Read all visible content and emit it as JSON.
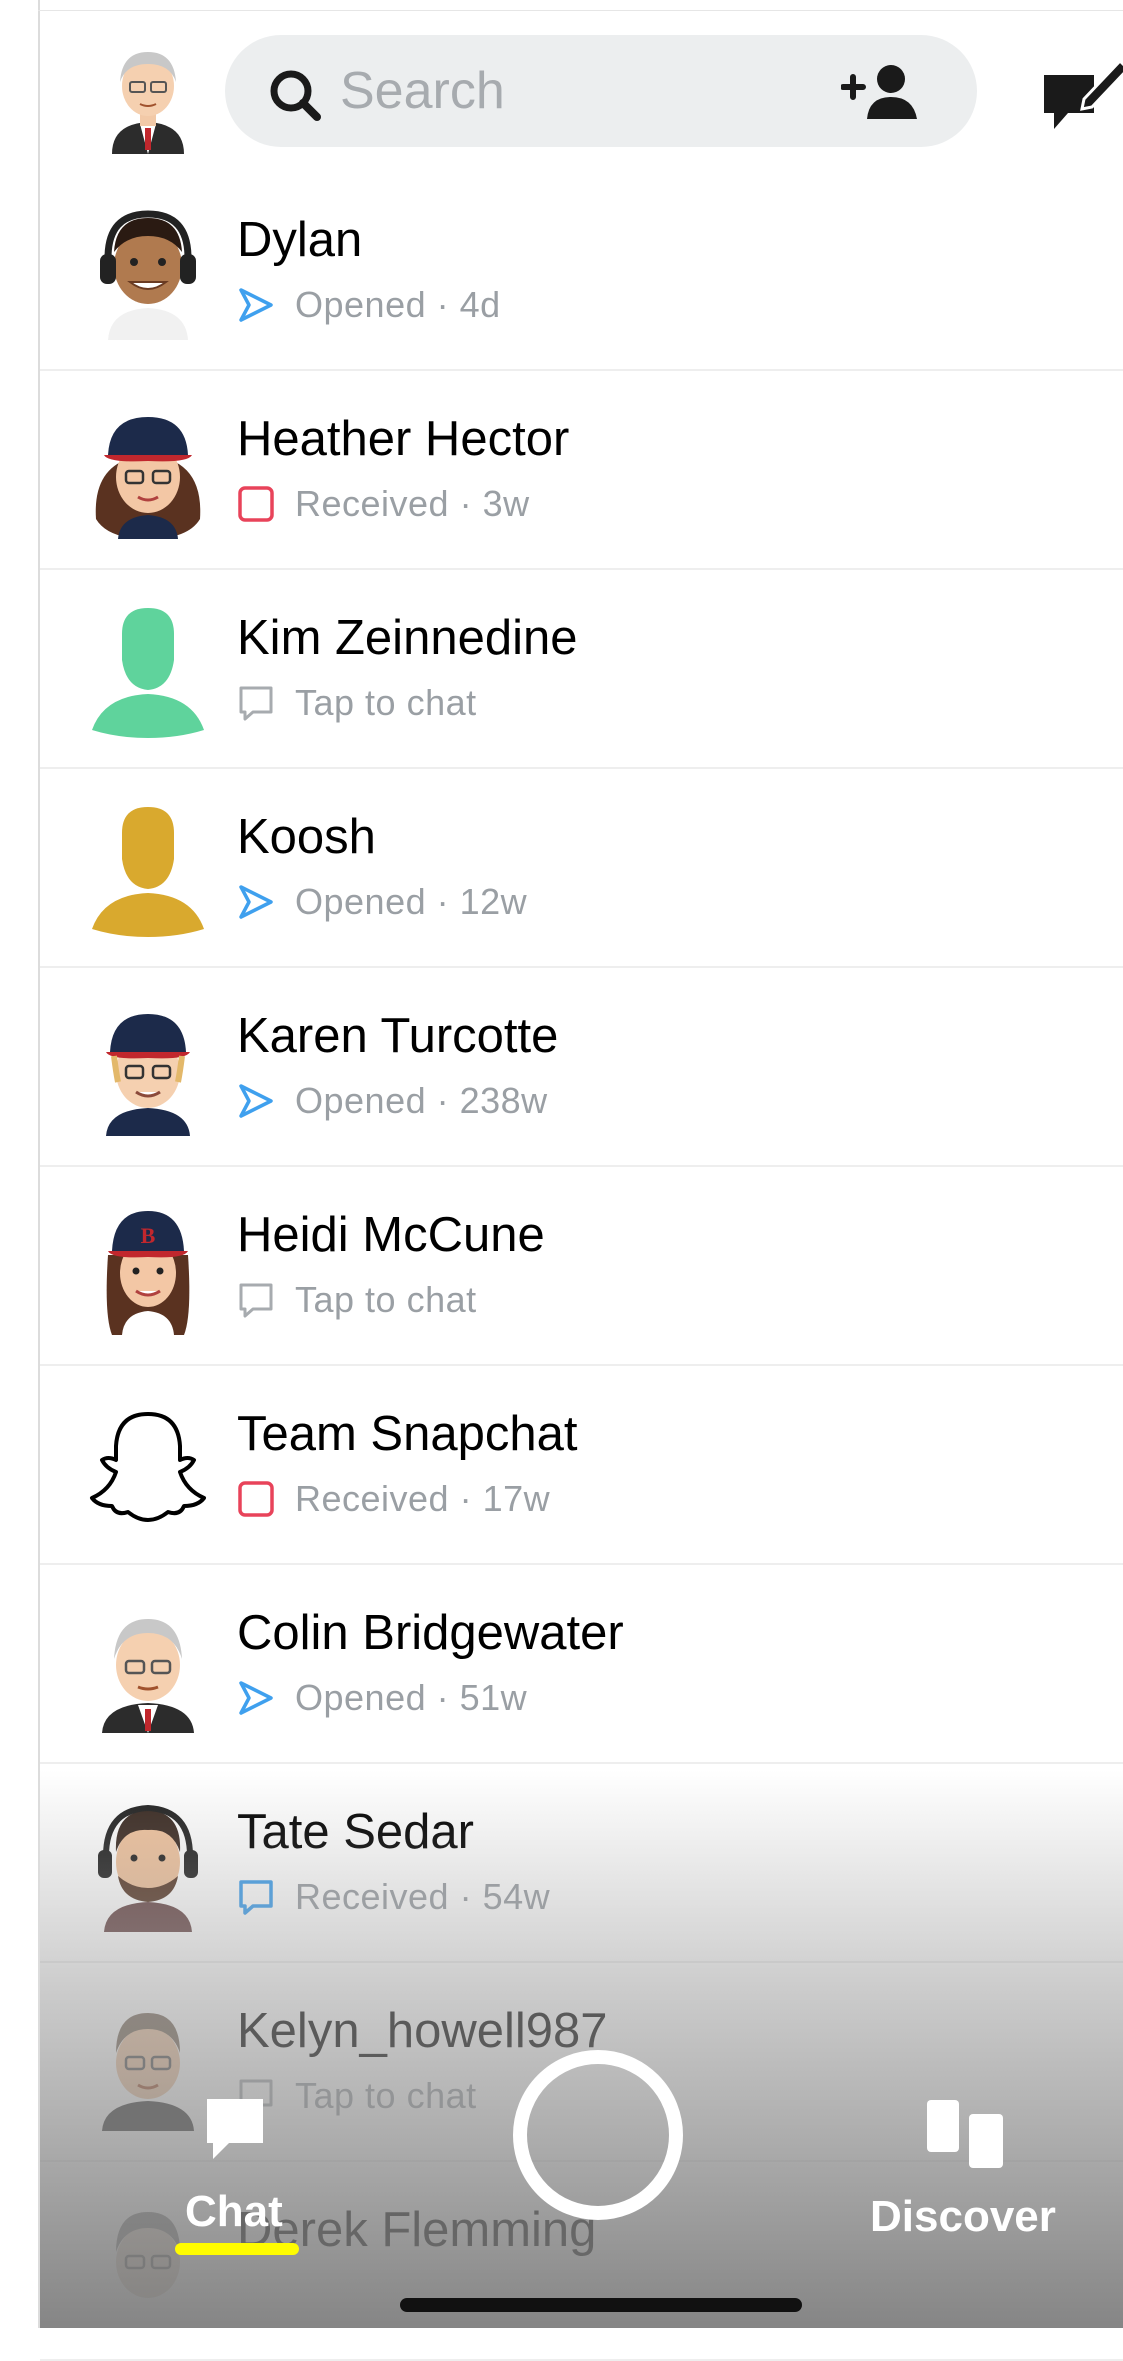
{
  "header": {
    "search_placeholder": "Search"
  },
  "chats": [
    {
      "name": "Dylan",
      "status": "Opened · 4d",
      "status_type": "opened",
      "avatar": "bitmoji-headphones"
    },
    {
      "name": "Heather Hector",
      "status": "Received · 3w",
      "status_type": "received-snap",
      "avatar": "bitmoji-cap-glasses"
    },
    {
      "name": "Kim Zeinnedine",
      "status": "Tap to chat",
      "status_type": "tap",
      "avatar": "silhouette",
      "avatar_color": "#5fd39c"
    },
    {
      "name": "Koosh",
      "status": "Opened · 12w",
      "status_type": "opened",
      "avatar": "silhouette",
      "avatar_color": "#d9a92e"
    },
    {
      "name": "Karen Turcotte",
      "status": "Opened · 238w",
      "status_type": "opened",
      "avatar": "bitmoji-cap-glasses"
    },
    {
      "name": "Heidi McCune",
      "status": "Tap to chat",
      "status_type": "tap",
      "avatar": "bitmoji-red-cap"
    },
    {
      "name": "Team Snapchat",
      "status": "Received · 17w",
      "status_type": "received-snap",
      "avatar": "ghost"
    },
    {
      "name": "Colin Bridgewater",
      "status": "Opened · 51w",
      "status_type": "opened",
      "avatar": "bitmoji-suit-glasses"
    },
    {
      "name": "Tate Sedar",
      "status": "Received · 54w",
      "status_type": "received-chat",
      "avatar": "bitmoji-beard"
    },
    {
      "name": "Kelyn_howell987",
      "status": "Tap to chat",
      "status_type": "tap",
      "avatar": "bitmoji-glasses"
    },
    {
      "name": "Derek Flemming",
      "status": "",
      "status_type": "none",
      "avatar": "bitmoji-glasses"
    }
  ],
  "nav": {
    "chat_label": "Chat",
    "discover_label": "Discover"
  },
  "colors": {
    "opened": "#3fa0ee",
    "received_snap": "#e8435a",
    "received_chat": "#3fa0ee",
    "tap": "#a7abaf",
    "accent_yellow": "#fffc00"
  }
}
